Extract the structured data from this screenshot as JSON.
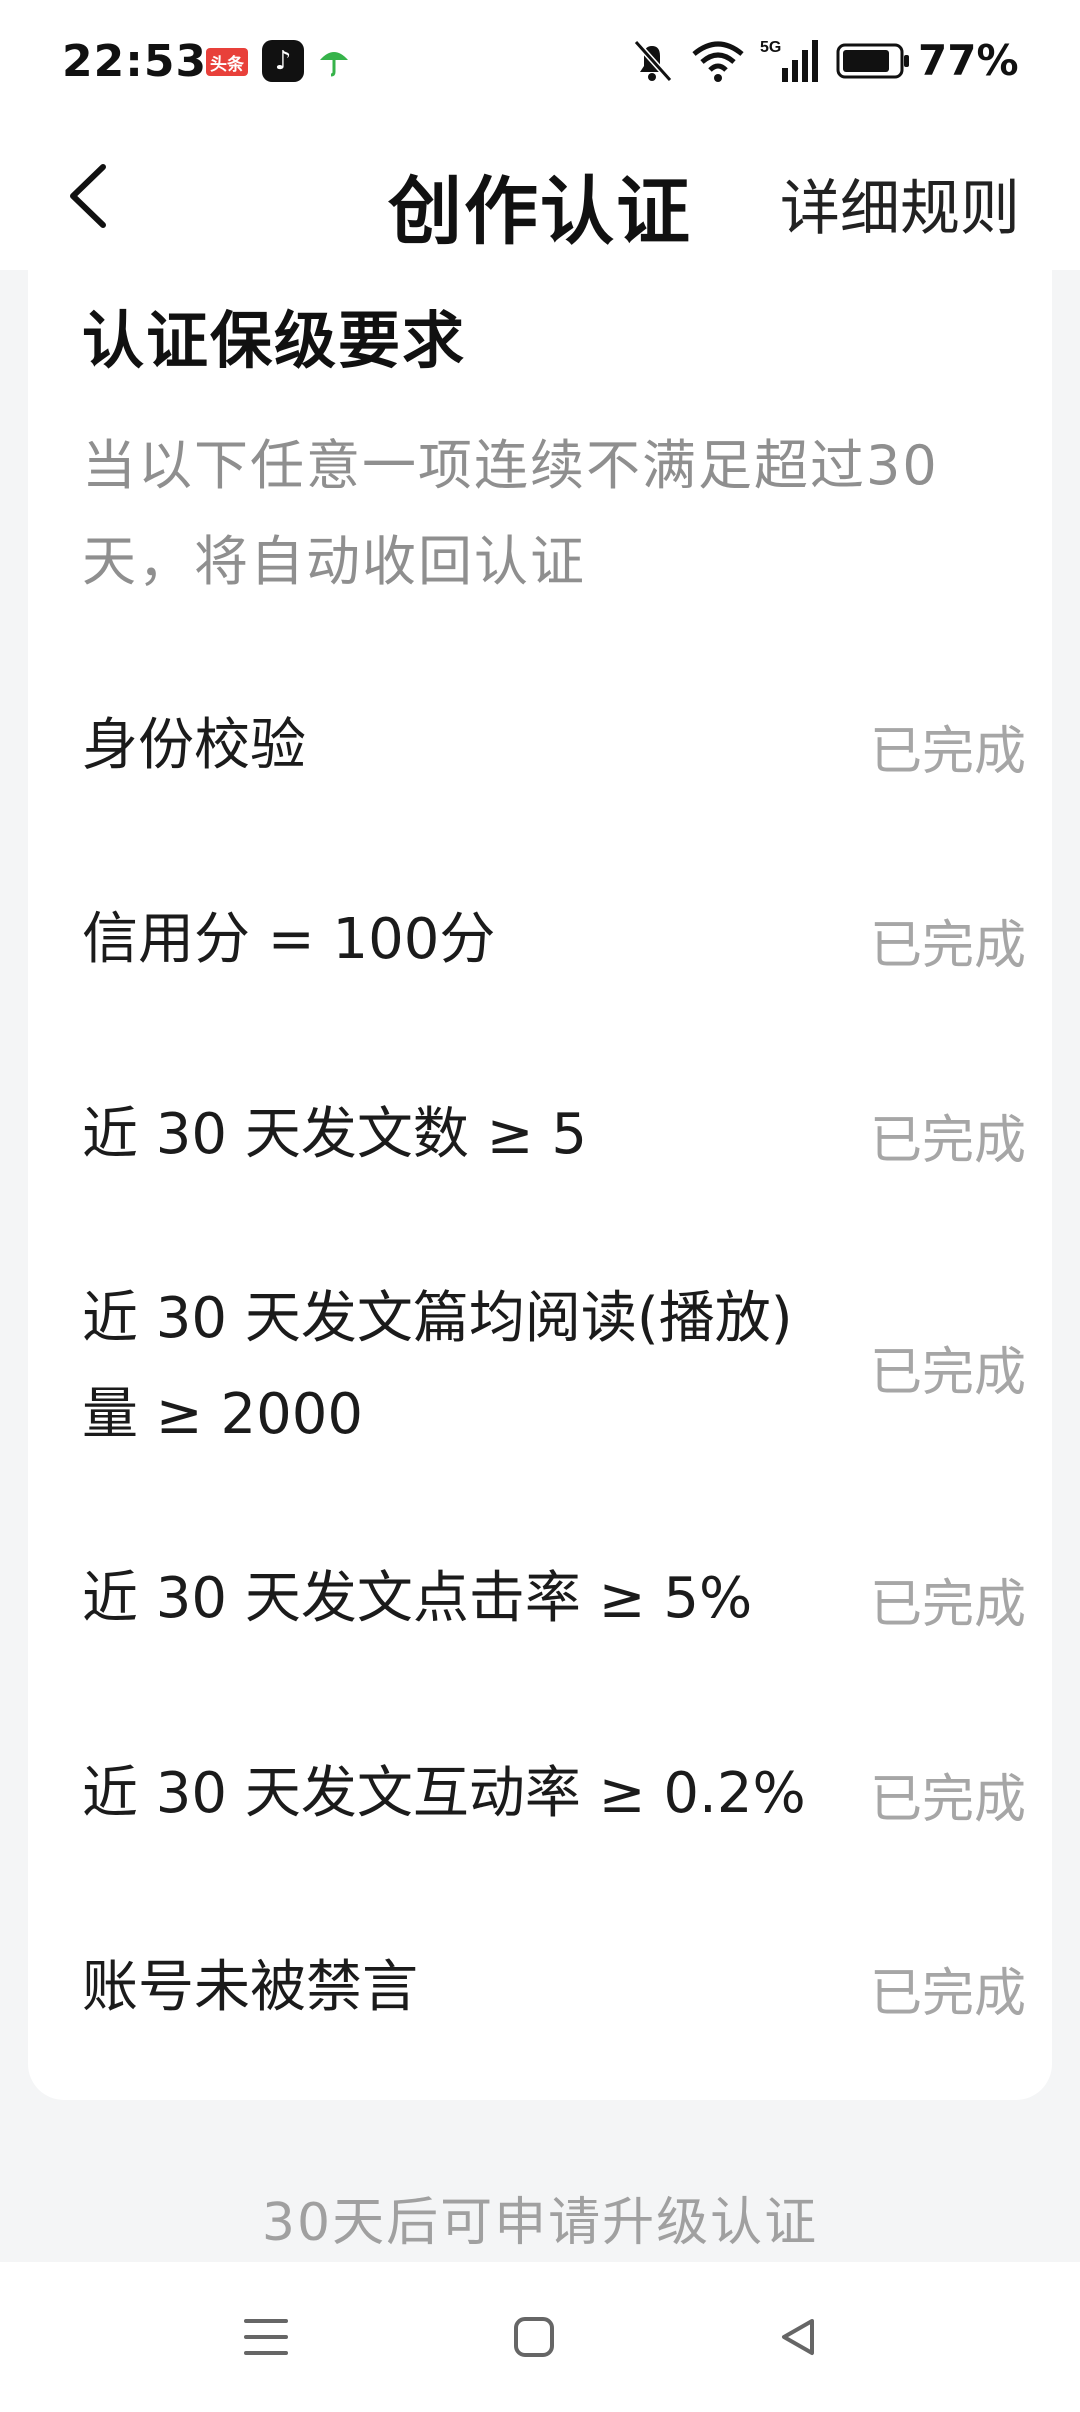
{
  "status_bar": {
    "time": "22:53",
    "toutiao_badge": "头条",
    "battery_percent": "77%",
    "network": "5G",
    "battery_level": 0.77
  },
  "header": {
    "title": "创作认证",
    "right_link": "详细规则"
  },
  "card": {
    "title": "认证保级要求",
    "description": "当以下任意一项连续不满足超过30天，将自动收回认证",
    "requirements": [
      {
        "label": "身份校验",
        "status": "已完成"
      },
      {
        "label": "信用分 = 100分",
        "status": "已完成"
      },
      {
        "label": "近 30 天发文数 ≥ 5",
        "status": "已完成"
      },
      {
        "label": "近 30 天发文篇均阅读(播放)量 ≥ 2000",
        "status": "已完成"
      },
      {
        "label": "近 30 天发文点击率 ≥ 5%",
        "status": "已完成"
      },
      {
        "label": "近 30 天发文互动率 ≥ 0.2%",
        "status": "已完成"
      },
      {
        "label": "账号未被禁言",
        "status": "已完成"
      }
    ]
  },
  "footer": {
    "upgrade_hint": "30天后可申请升级认证"
  },
  "colors": {
    "background": "#f4f5f6",
    "card": "#ffffff",
    "muted_text": "#a6a6a6",
    "toutiao_red": "#e8403a"
  }
}
